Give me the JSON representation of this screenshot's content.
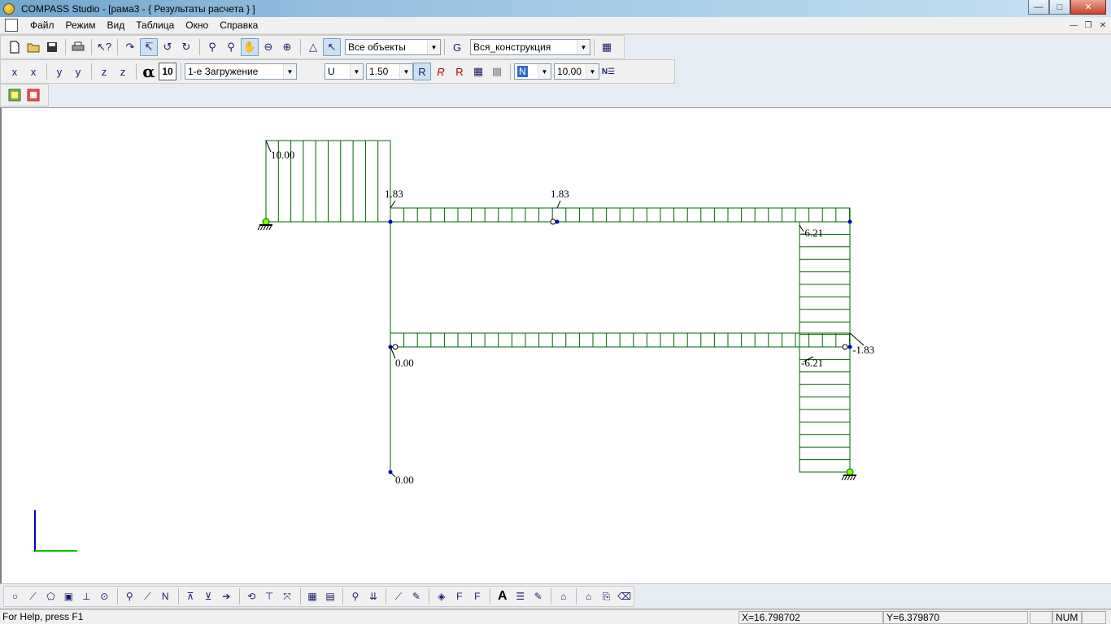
{
  "titlebar": {
    "title": "COMPASS  Studio - [рама3 - { Результаты расчета } ]",
    "buttons": [
      "minimize",
      "maximize",
      "close"
    ]
  },
  "menu": {
    "items": [
      "Файл",
      "Режим",
      "Вид",
      "Таблица",
      "Окно",
      "Справка"
    ]
  },
  "toolbar1": {
    "objects_combo": "Все объекты",
    "construction_combo": "Вся_конструкция"
  },
  "toolbar2": {
    "alpha_symbol": "α",
    "alpha_value": "10",
    "load_case_combo": "1-е Загружение",
    "component_combo": "U",
    "scale_combo": "1.50",
    "force_combo": "N",
    "value_combo": "10.00"
  },
  "diagram": {
    "labels": [
      {
        "text": "10.00"
      },
      {
        "text": "1.83"
      },
      {
        "text": "1.83"
      },
      {
        "text": "-6.21"
      },
      {
        "text": "0.00"
      },
      {
        "text": "-6.21"
      },
      {
        "text": "-1.83"
      },
      {
        "text": "0.00"
      }
    ],
    "line_color": "#006400",
    "node_color": "#0000c8",
    "axis_x_color": "#00c800",
    "axis_y_color": "#0000c8"
  },
  "statusbar": {
    "help": "For Help, press F1",
    "x_coord": "X=16.798702",
    "y_coord": "Y=6.379870",
    "num": "NUM"
  },
  "icons": {
    "toolbar1": [
      "new-file-icon",
      "open-folder-icon",
      "save-icon",
      "print-icon",
      "help-pointer-icon",
      "rotate-x-icon",
      "rotate-y-icon",
      "rotate-z-icon",
      "rotate-view-icon",
      "zoom-icon",
      "zoom-window-icon",
      "pan-icon",
      "zoom-out-icon",
      "zoom-in-icon",
      "support-icon",
      "select-arrow-icon",
      "group-icon",
      "properties-icon"
    ],
    "toolbar2": [
      "axis-x-icon",
      "axis-x2-icon",
      "axis-y-icon",
      "axis-y2-icon",
      "axis-z-icon",
      "axis-z2-icon",
      "results-icon",
      "results-r-icon",
      "results-rr-icon",
      "table-icon",
      "grid-icon",
      "labels-icon"
    ],
    "toolbar3": [
      "calc-icon",
      "model-icon"
    ],
    "bottom": [
      "node-icon",
      "bar-icon",
      "plate-icon",
      "solid-icon",
      "axes-icon",
      "hinge-icon",
      "node-load-icon",
      "bar-load-icon",
      "nodal-force-icon",
      "support-fix-icon",
      "support-pin-icon",
      "force-icon",
      "spring-icon",
      "section-icon",
      "rigid-icon",
      "mesh-icon",
      "material-icon",
      "temperature-icon",
      "distribute-icon",
      "measure-icon",
      "pencil-icon",
      "checker-icon",
      "loads-f1-icon",
      "loads-f2-icon",
      "text-icon",
      "list-icon",
      "draw-icon",
      "frame-icon",
      "frame2-icon",
      "copy-icon",
      "erase-icon"
    ]
  }
}
